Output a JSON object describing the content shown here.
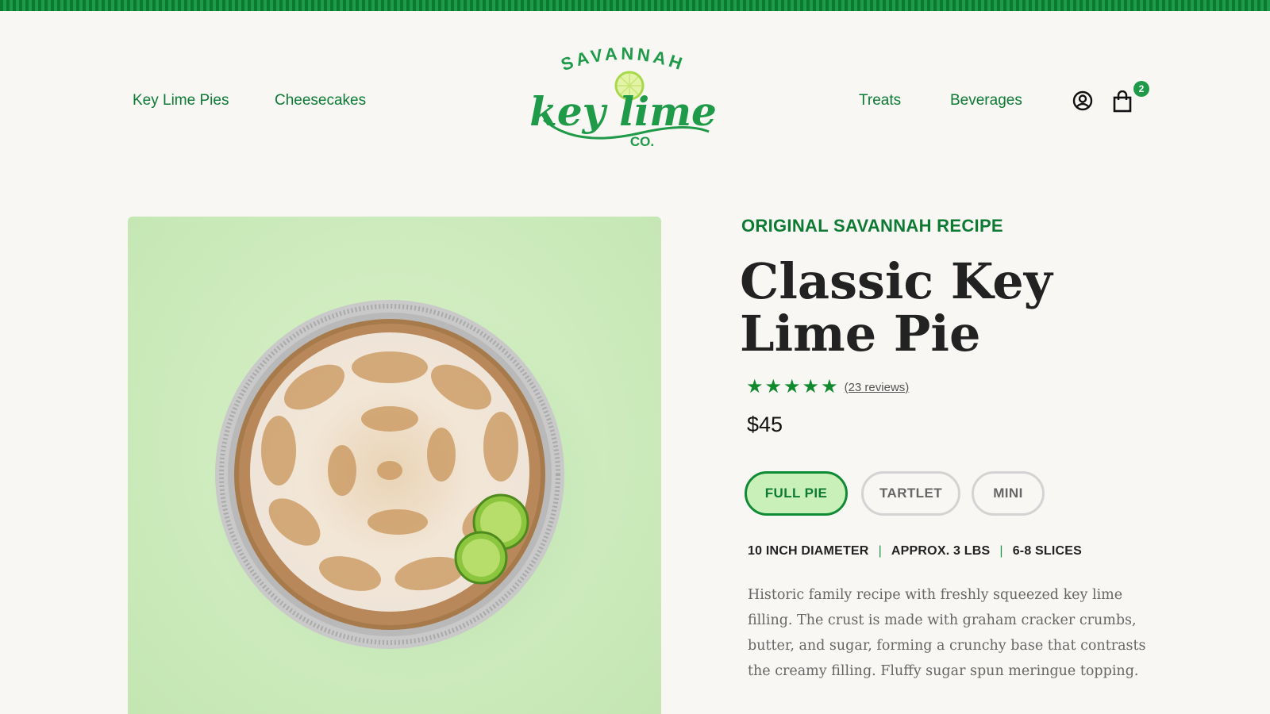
{
  "brand": {
    "logo_line1": "SAVANNAH",
    "logo_line2": "key lime",
    "logo_line3": "CO.",
    "color_primary": "#0d7a34",
    "color_accent": "#1f9a48"
  },
  "nav": {
    "left": [
      {
        "label": "Key Lime Pies"
      },
      {
        "label": "Cheesecakes"
      }
    ],
    "right": [
      {
        "label": "Treats"
      },
      {
        "label": "Beverages"
      }
    ],
    "account_icon": "user-circle-icon",
    "cart_icon": "shopping-bag-icon",
    "cart_count": "2"
  },
  "product": {
    "eyebrow": "ORIGINAL SAVANNAH RECIPE",
    "title": "Classic Key Lime Pie",
    "rating": 5,
    "reviews_label": "(23 reviews)",
    "price": "$45",
    "variants": [
      {
        "label": "FULL PIE",
        "selected": true
      },
      {
        "label": "TARTLET",
        "selected": false
      },
      {
        "label": "MINI",
        "selected": false
      }
    ],
    "specs": [
      "10 INCH DIAMETER",
      "APPROX. 3 LBS",
      "6-8 SLICES"
    ],
    "description": "Historic family recipe with freshly squeezed key lime filling. The crust is made with graham cracker crumbs, butter, and sugar, forming a crunchy base that contrasts the creamy filling. Fluffy sugar spun meringue topping.",
    "image_icon": "key-lime-pie-photo"
  }
}
